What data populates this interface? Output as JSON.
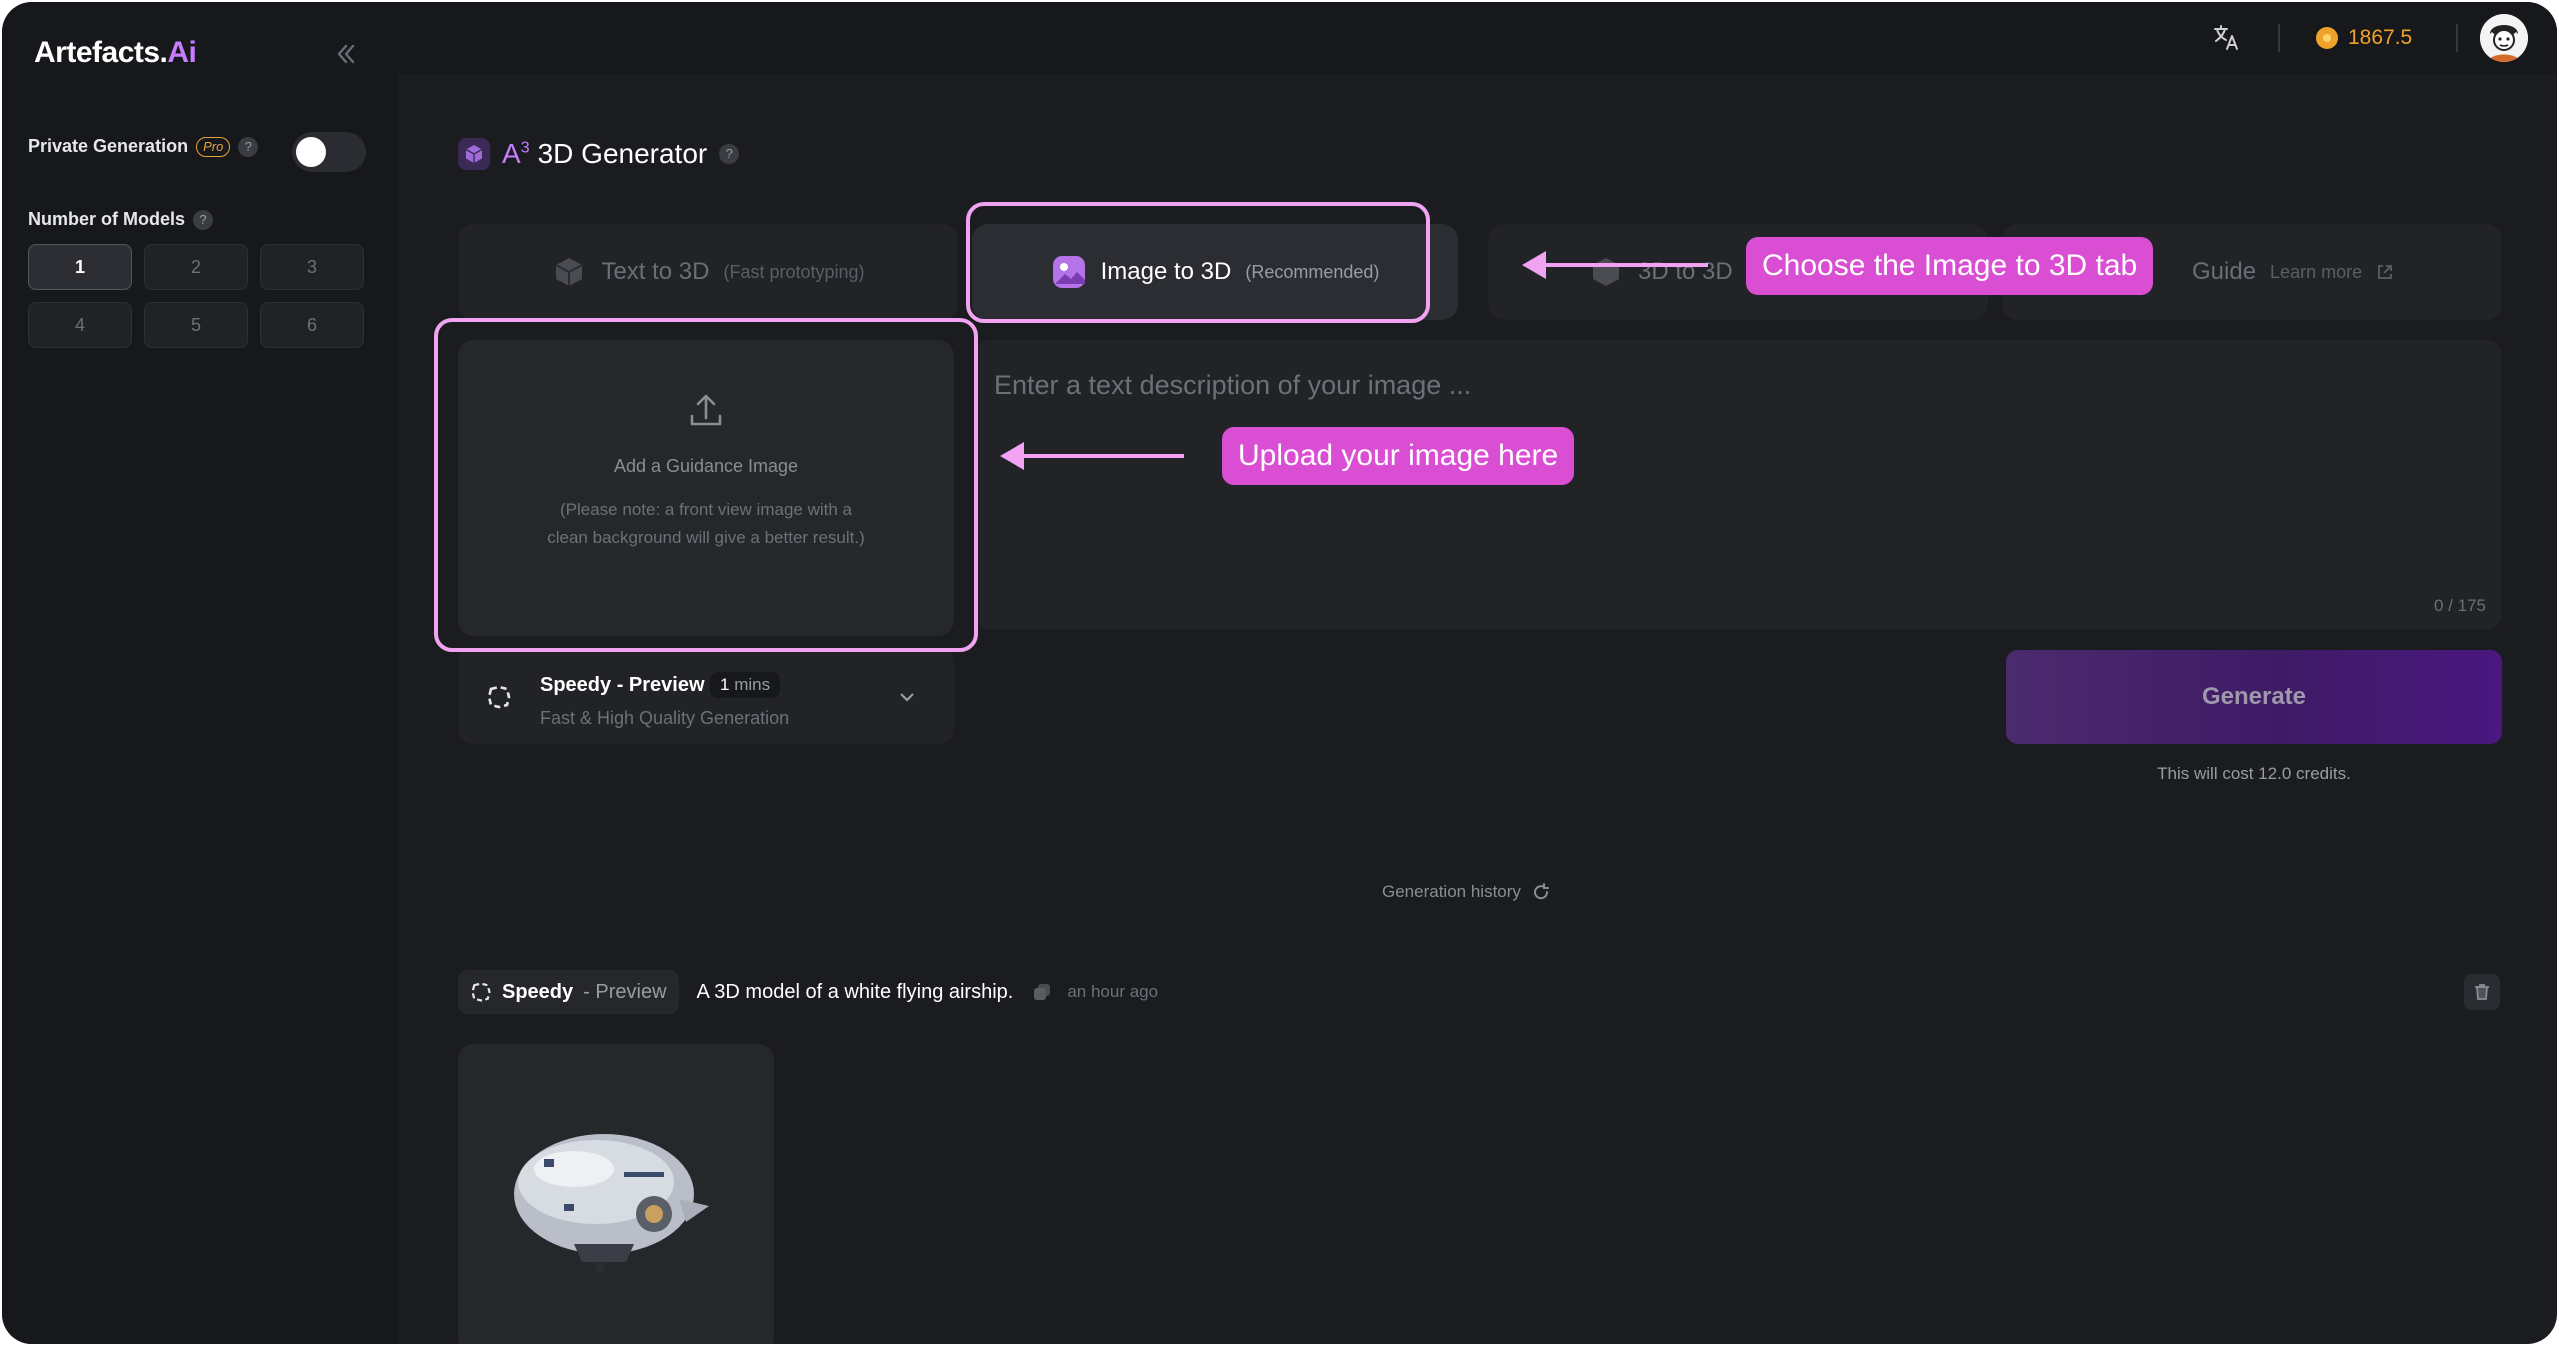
{
  "app": {
    "logo_main": "Artefacts.",
    "logo_accent": "Ai"
  },
  "sidebar": {
    "private_label": "Private Generation",
    "pro_badge": "Pro",
    "help": "?",
    "private_enabled": false,
    "models_label": "Number of Models",
    "model_counts": [
      "1",
      "2",
      "3",
      "4",
      "5",
      "6"
    ],
    "selected_count": "1"
  },
  "topbar": {
    "credits": "1867.5"
  },
  "page": {
    "title_prefix": "A",
    "title_sup": "3",
    "title": "3D Generator"
  },
  "tabs": [
    {
      "label": "Text to 3D",
      "sub": "(Fast prototyping)"
    },
    {
      "label": "Image to 3D",
      "sub": "(Recommended)"
    },
    {
      "label": "3D to 3D",
      "sub": ""
    },
    {
      "label": "Guide",
      "sub": "Learn more"
    }
  ],
  "upload": {
    "title": "Add a Guidance Image",
    "note": "(Please note: a front view image with a clean background will give a better result.)"
  },
  "prompt_input": {
    "placeholder": "Enter a text description of your image ...",
    "counter": "0 / 175"
  },
  "model": {
    "name": "Speedy - Preview",
    "time_value": "1",
    "time_unit": "mins",
    "description": "Fast & High Quality Generation"
  },
  "generate": {
    "label": "Generate",
    "cost_text": "This will cost 12.0 credits."
  },
  "history": {
    "label": "Generation history",
    "items": [
      {
        "model_a": "Speedy",
        "model_b": "- Preview",
        "prompt": "A 3D model of a white flying airship.",
        "time": "an hour ago"
      }
    ]
  },
  "annotations": {
    "tab_hint": "Choose the Image to 3D tab",
    "upload_hint": "Upload your image here"
  },
  "colors": {
    "accent_purple": "#c77dff",
    "annotation_pink": "#d94ed3",
    "coin": "#f0a32a"
  }
}
